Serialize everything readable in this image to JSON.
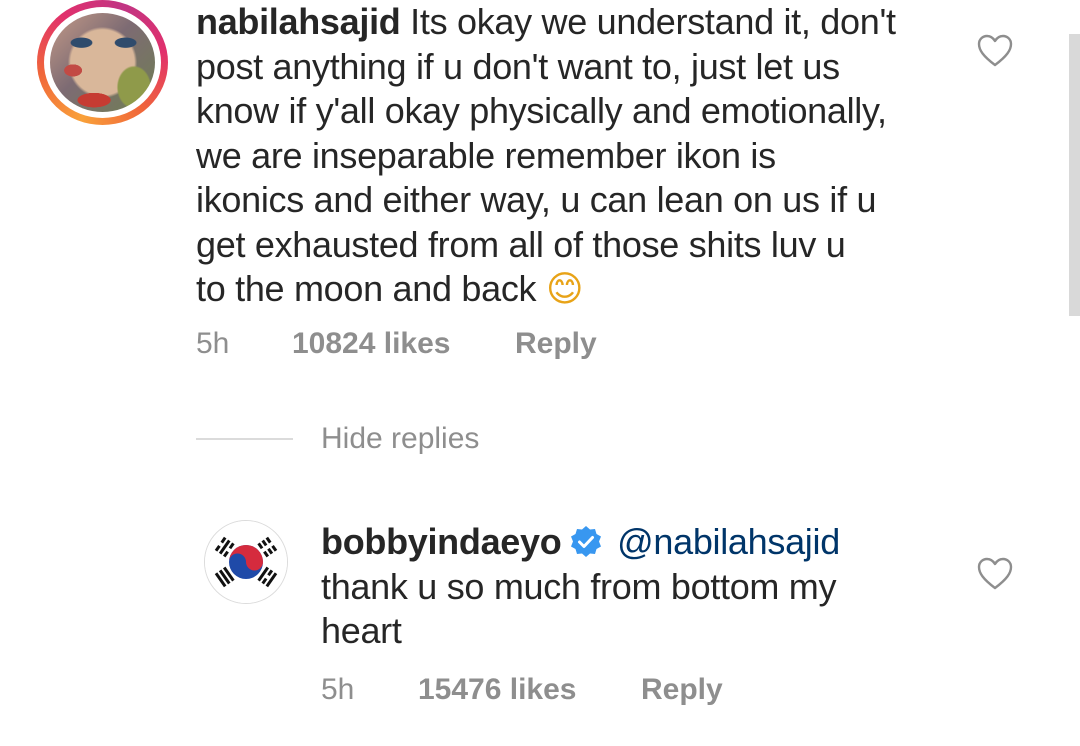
{
  "comments": [
    {
      "username": "nabilahsajid",
      "lines": [
        "Its okay we understand it, don't",
        "post anything if u don't want to, just let us",
        "know if y'all okay physically and emotionally,",
        "we are inseparable remember ikon is",
        "ikonics and either way, u can lean on us if u",
        "get exhausted from all of those shits luv u",
        "to the moon and back"
      ],
      "emoji": "😊",
      "time": "5h",
      "likes": "10824 likes",
      "reply_label": "Reply"
    }
  ],
  "hide_replies_label": "Hide replies",
  "replies": [
    {
      "username": "bobbyindaeyo",
      "verified": true,
      "mention": "@nabilahsajid",
      "lines": [
        "thank u so much from bottom my",
        "heart"
      ],
      "time": "5h",
      "likes": "15476 likes",
      "reply_label": "Reply"
    }
  ],
  "icons": {
    "like": "heart-outline-icon",
    "verified": "verified-badge-icon",
    "avatar2": "south-korea-flag"
  },
  "colors": {
    "text": "#262626",
    "meta": "#8e8e8e",
    "mention": "#003569",
    "verified": "#3897f0"
  }
}
